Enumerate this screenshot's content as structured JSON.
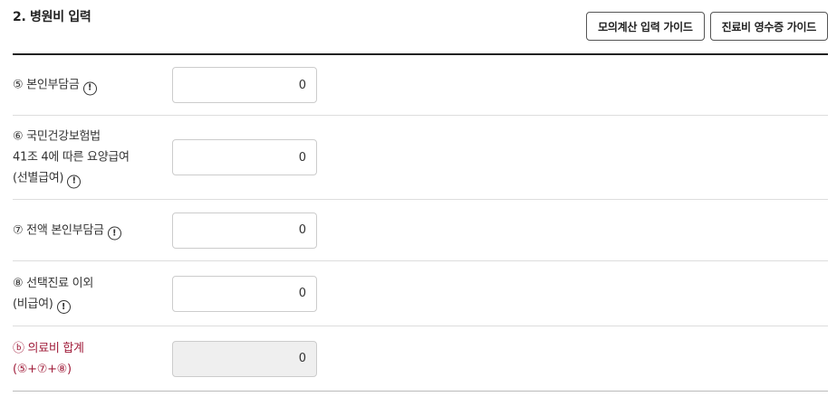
{
  "section": {
    "title": "2. 병원비 입력"
  },
  "guides": {
    "calc_guide_label": "모의계산 입력 가이드",
    "receipt_guide_label": "진료비 영수증 가이드"
  },
  "icons": {
    "info_glyph": "!"
  },
  "rows": [
    {
      "label_lines": [
        "⑤ 본인부담금"
      ],
      "value": "0",
      "has_info": true,
      "readonly": false
    },
    {
      "label_lines": [
        "⑥ 국민건강보험법",
        "41조 4에 따른 요양급여",
        "(선별급여)"
      ],
      "value": "0",
      "has_info": true,
      "readonly": false
    },
    {
      "label_lines": [
        "⑦ 전액 본인부담금"
      ],
      "value": "0",
      "has_info": true,
      "readonly": false
    },
    {
      "label_lines": [
        "⑧ 선택진료 이외",
        "(비급여)"
      ],
      "value": "0",
      "has_info": true,
      "readonly": false
    },
    {
      "label_lines": [
        "ⓑ 의료비 합계",
        "(⑤+⑦+⑧)"
      ],
      "value": "0",
      "has_info": false,
      "readonly": true
    }
  ],
  "colors": {
    "total_label": "#a01c3a",
    "readonly_bg": "#efefef",
    "rule": "#222222"
  }
}
